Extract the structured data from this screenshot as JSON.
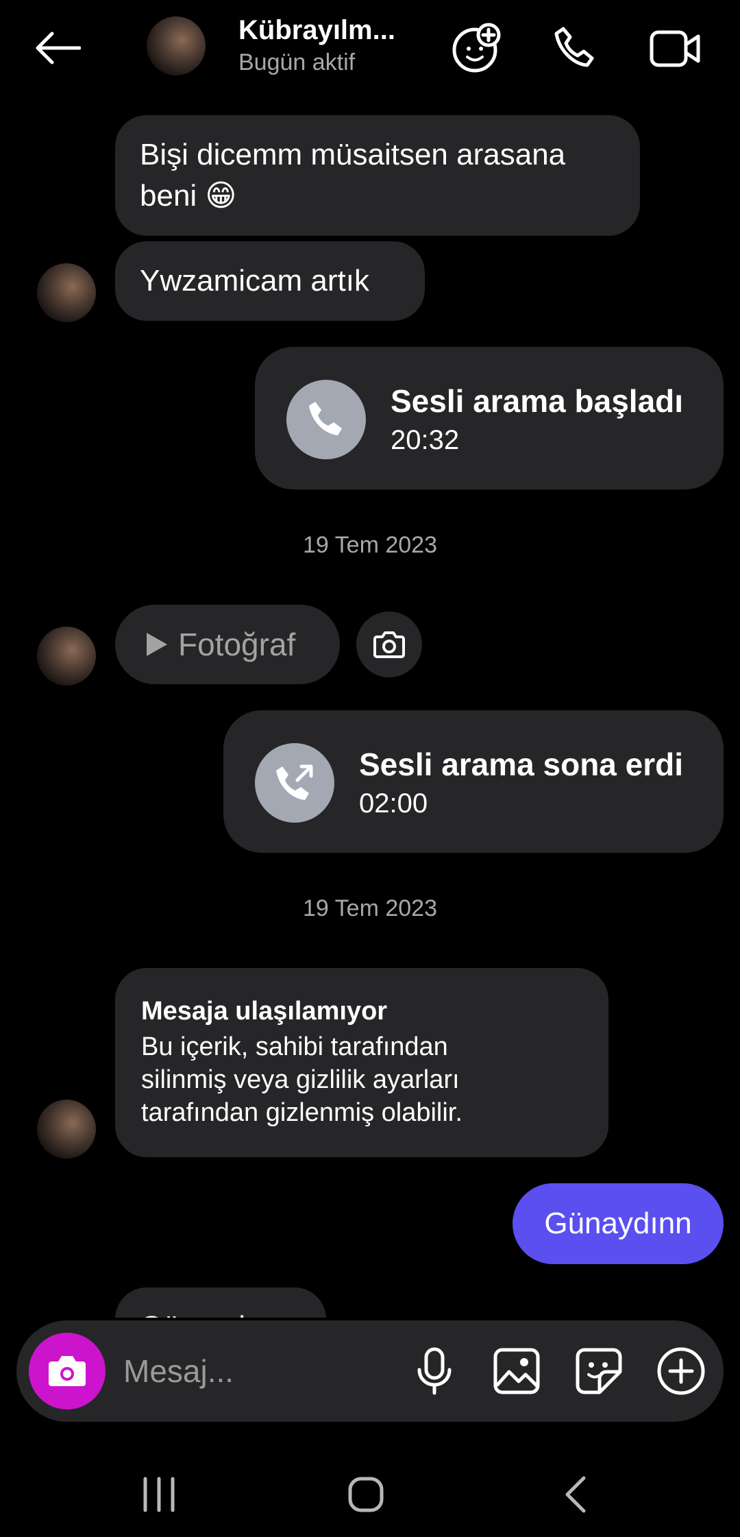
{
  "header": {
    "contact_name": "Kübrayılm...",
    "status": "Bugün aktif",
    "icons": [
      "back-arrow-icon",
      "add-person-icon",
      "phone-icon",
      "video-icon"
    ]
  },
  "messages": {
    "m1": {
      "line1": "Bişi dicemm müsaitsen arasana",
      "line2": "beni 😁"
    },
    "m2": {
      "text": "Ywzamicam artık"
    },
    "call_started": {
      "title": "Sesli arama başladı",
      "time": "20:32"
    },
    "date1": "19 Tem 2023",
    "photo": {
      "label": "Fotoğraf"
    },
    "call_ended": {
      "title": "Sesli arama sona erdi",
      "time": "02:00"
    },
    "date2": "19 Tem 2023",
    "unavailable": {
      "title": "Mesaja ulaşılamıyor",
      "line1": "Bu içerik, sahibi tarafından",
      "line2": "silinmiş veya gizlilik ayarları",
      "line3": "tarafından gizlenmiş olabilir."
    },
    "out1": {
      "text": "Günaydınn"
    },
    "partial_in": {
      "text": "Günaydınn"
    }
  },
  "composer": {
    "placeholder": "Mesaj...",
    "icons": [
      "camera-icon",
      "microphone-icon",
      "gallery-icon",
      "sticker-icon",
      "plus-icon"
    ]
  },
  "colors": {
    "background": "#000000",
    "incoming_bubble": "#262628",
    "outgoing_bubble": "#5b4ff0",
    "camera_button": "#cc14cc",
    "muted_text": "#a8a8a8"
  }
}
